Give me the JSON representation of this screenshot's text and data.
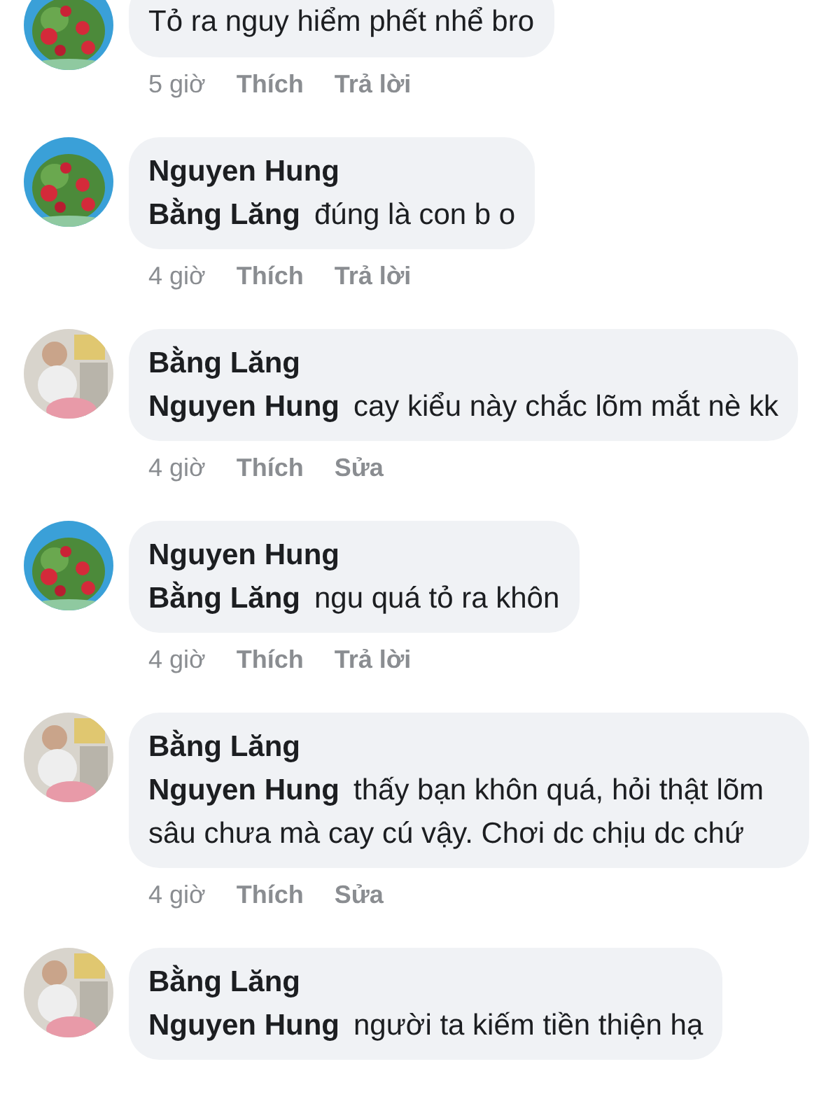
{
  "comments": [
    {
      "kind": "flowers",
      "text": "Tỏ ra nguy hiểm phết nhể bro",
      "time": "5 giờ",
      "actions": [
        "Thích",
        "Trả lời"
      ]
    },
    {
      "kind": "flowers",
      "author": "Nguyen Hung",
      "mention": "Bằng Lăng",
      "text": "đúng là con b o",
      "time": "4 giờ",
      "actions": [
        "Thích",
        "Trả lời"
      ]
    },
    {
      "kind": "figure",
      "author": "Bằng Lăng",
      "mention": "Nguyen Hung",
      "text": "cay kiểu này chắc lõm mắt nè kk",
      "time": "4 giờ",
      "actions": [
        "Thích",
        "Sửa"
      ]
    },
    {
      "kind": "flowers",
      "author": "Nguyen Hung",
      "mention": "Bằng Lăng",
      "text": "ngu quá tỏ ra khôn",
      "time": "4 giờ",
      "actions": [
        "Thích",
        "Trả lời"
      ]
    },
    {
      "kind": "figure",
      "author": "Bằng Lăng",
      "mention": "Nguyen Hung",
      "text": "thấy bạn khôn quá, hỏi thật lõm sâu chưa mà cay cú vậy. Chơi dc chịu dc chứ",
      "time": "4 giờ",
      "actions": [
        "Thích",
        "Sửa"
      ]
    },
    {
      "kind": "figure",
      "author": "Bằng Lăng",
      "mention": "Nguyen Hung",
      "text": "người ta kiếm tiền thiện hạ"
    }
  ]
}
